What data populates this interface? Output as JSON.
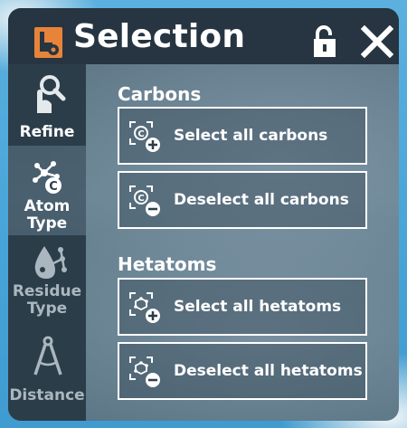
{
  "window": {
    "title": "Selection",
    "accent_color": "#e8833a",
    "header_color": "#263541"
  },
  "header": {
    "logo_icon": "app-logo-icon",
    "lock_icon": "unlock-icon",
    "close_icon": "close-icon"
  },
  "sidebar": {
    "items": [
      {
        "label": "Refine",
        "icon": "magnifier-hand-icon",
        "active": false
      },
      {
        "label": "Atom Type",
        "label_line1": "Atom",
        "label_line2": "Type",
        "icon": "atom-carbon-icon",
        "active": true
      },
      {
        "label": "Residue Type",
        "label_line1": "Residue",
        "label_line2": "Type",
        "icon": "residue-drop-icon",
        "active": false
      },
      {
        "label": "Distance",
        "icon": "compass-icon",
        "active": false
      }
    ]
  },
  "sections": [
    {
      "title": "Carbons",
      "actions": [
        {
          "label": "Select all carbons",
          "icon": "carbon-add-icon"
        },
        {
          "label": "Deselect all carbons",
          "icon": "carbon-remove-icon"
        }
      ]
    },
    {
      "title": "Hetatoms",
      "actions": [
        {
          "label": "Select all hetatoms",
          "icon": "hetatom-add-icon"
        },
        {
          "label": "Deselect all hetatoms",
          "icon": "hetatom-remove-icon"
        }
      ]
    }
  ]
}
